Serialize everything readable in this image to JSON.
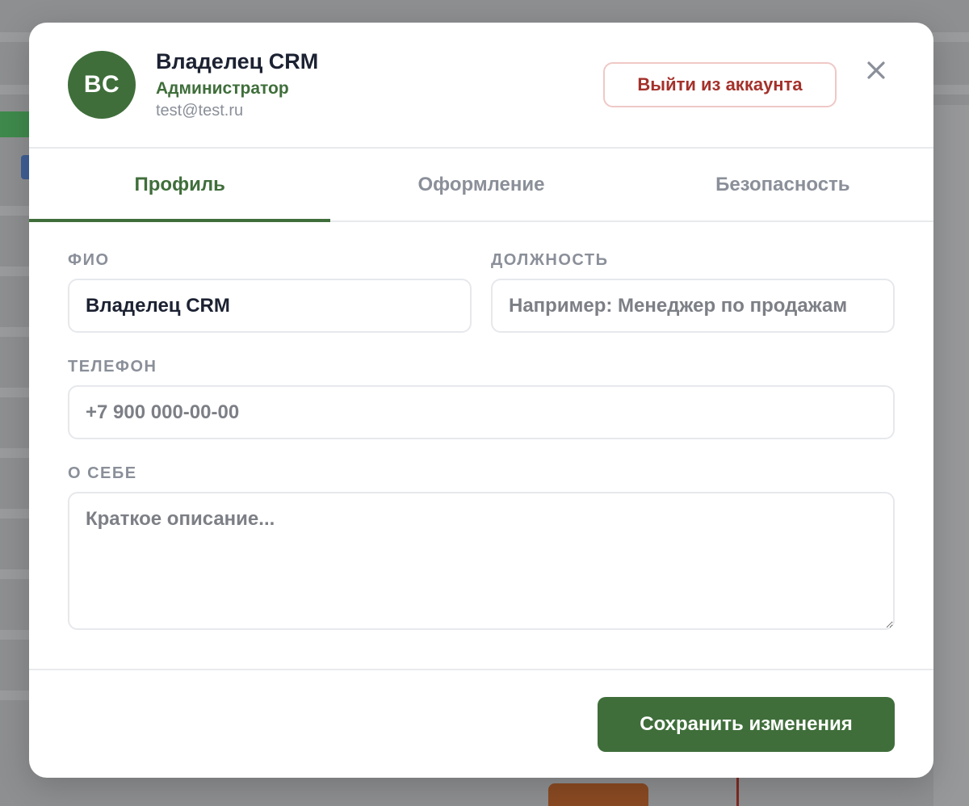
{
  "profile": {
    "initials": "BC",
    "name": "Владелец CRM",
    "role": "Администратор",
    "email": "test@test.ru"
  },
  "header": {
    "logout_label": "Выйти из аккаунта",
    "close_icon": "close-icon"
  },
  "tabs": [
    {
      "label": "Профиль",
      "active": true
    },
    {
      "label": "Оформление",
      "active": false
    },
    {
      "label": "Безопасность",
      "active": false
    }
  ],
  "form": {
    "full_name": {
      "label": "ФИО",
      "value": "Владелец CRM",
      "placeholder": ""
    },
    "position": {
      "label": "ДОЛЖНОСТЬ",
      "value": "",
      "placeholder": "Например: Менеджер по продажам"
    },
    "phone": {
      "label": "ТЕЛЕФОН",
      "value": "",
      "placeholder": "+7 900 000-00-00"
    },
    "about": {
      "label": "О СЕБЕ",
      "value": "",
      "placeholder": "Краткое описание..."
    }
  },
  "footer": {
    "save_label": "Сохранить изменения"
  },
  "colors": {
    "accent": "#3f6e3a",
    "danger": "#a4312b",
    "muted": "#8a8f99",
    "text": "#1c2232"
  }
}
